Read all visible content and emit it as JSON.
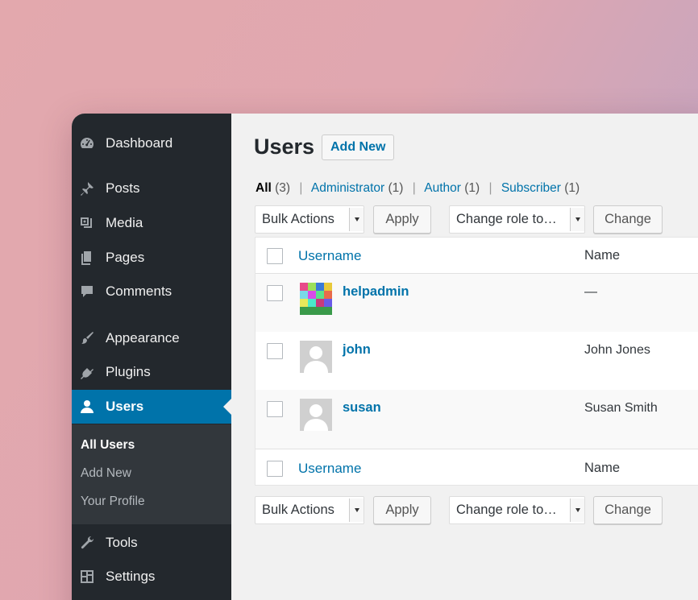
{
  "sidebar": {
    "menu": [
      {
        "label": "Dashboard",
        "icon": "dashboard-icon"
      },
      {
        "label": "Posts",
        "icon": "pin-icon"
      },
      {
        "label": "Media",
        "icon": "media-icon"
      },
      {
        "label": "Pages",
        "icon": "pages-icon"
      },
      {
        "label": "Comments",
        "icon": "comment-icon"
      },
      {
        "label": "Appearance",
        "icon": "paintbrush-icon"
      },
      {
        "label": "Plugins",
        "icon": "plugin-icon"
      },
      {
        "label": "Users",
        "icon": "user-icon"
      },
      {
        "label": "Tools",
        "icon": "wrench-icon"
      },
      {
        "label": "Settings",
        "icon": "settings-icon"
      }
    ],
    "submenu": [
      "All Users",
      "Add New",
      "Your Profile"
    ]
  },
  "page": {
    "title": "Users",
    "add_new": "Add New"
  },
  "filters": {
    "all": "All",
    "all_count": "(3)",
    "administrator": "Administrator",
    "administrator_count": "(1)",
    "author": "Author",
    "author_count": "(1)",
    "subscriber": "Subscriber",
    "subscriber_count": "(1)",
    "separator": "|"
  },
  "actions": {
    "bulk_actions": "Bulk Actions",
    "apply": "Apply",
    "change_role": "Change role to…",
    "change": "Change"
  },
  "table": {
    "columns": {
      "username": "Username",
      "name": "Name"
    },
    "rows": [
      {
        "username": "helpadmin",
        "name": "—"
      },
      {
        "username": "john",
        "name": "John Jones"
      },
      {
        "username": "susan",
        "name": "Susan Smith"
      }
    ]
  },
  "colors": {
    "sidebar_bg": "#23282d",
    "submenu_bg": "#32373c",
    "accent": "#0073aa",
    "content_bg": "#f1f1f1"
  }
}
